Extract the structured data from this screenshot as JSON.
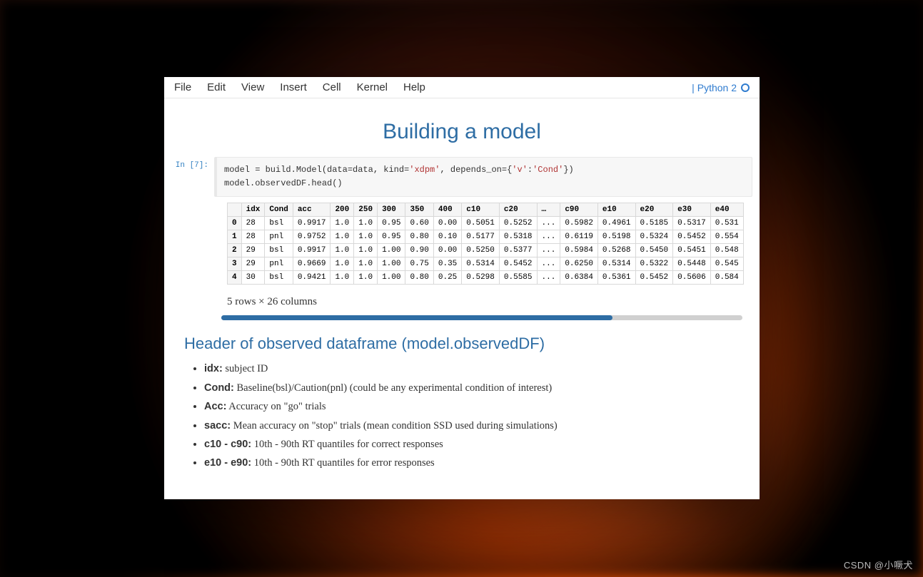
{
  "menubar": {
    "items": [
      "File",
      "Edit",
      "View",
      "Insert",
      "Cell",
      "Kernel",
      "Help"
    ],
    "kernel_name": "Python 2"
  },
  "title": "Building a model",
  "code": {
    "prompt": "In [7]:",
    "line1a": "model = build.Model(data=data, kind=",
    "line1b": "'xdpm'",
    "line1c": ", depends_on={",
    "line1d": "'v'",
    "line1e": ":",
    "line1f": "'Cond'",
    "line1g": "})",
    "line2": "model.observedDF.head()"
  },
  "table": {
    "columns": [
      "idx",
      "Cond",
      "acc",
      "200",
      "250",
      "300",
      "350",
      "400",
      "c10",
      "c20",
      "…",
      "c90",
      "e10",
      "e20",
      "e30",
      "e40"
    ],
    "rows": [
      {
        "index": "0",
        "cells": [
          "28",
          "bsl",
          "0.9917",
          "1.0",
          "1.0",
          "0.95",
          "0.60",
          "0.00",
          "0.5051",
          "0.5252",
          "...",
          "0.5982",
          "0.4961",
          "0.5185",
          "0.5317",
          "0.531"
        ]
      },
      {
        "index": "1",
        "cells": [
          "28",
          "pnl",
          "0.9752",
          "1.0",
          "1.0",
          "0.95",
          "0.80",
          "0.10",
          "0.5177",
          "0.5318",
          "...",
          "0.6119",
          "0.5198",
          "0.5324",
          "0.5452",
          "0.554"
        ]
      },
      {
        "index": "2",
        "cells": [
          "29",
          "bsl",
          "0.9917",
          "1.0",
          "1.0",
          "1.00",
          "0.90",
          "0.00",
          "0.5250",
          "0.5377",
          "...",
          "0.5984",
          "0.5268",
          "0.5450",
          "0.5451",
          "0.548"
        ]
      },
      {
        "index": "3",
        "cells": [
          "29",
          "pnl",
          "0.9669",
          "1.0",
          "1.0",
          "1.00",
          "0.75",
          "0.35",
          "0.5314",
          "0.5452",
          "...",
          "0.6250",
          "0.5314",
          "0.5322",
          "0.5448",
          "0.545"
        ]
      },
      {
        "index": "4",
        "cells": [
          "30",
          "bsl",
          "0.9421",
          "1.0",
          "1.0",
          "1.00",
          "0.80",
          "0.25",
          "0.5298",
          "0.5585",
          "...",
          "0.6384",
          "0.5361",
          "0.5452",
          "0.5606",
          "0.584"
        ]
      }
    ],
    "footer": "5 rows × 26 columns"
  },
  "section_header": "Header of observed dataframe (model.observedDF)",
  "fields": [
    {
      "name": "idx:",
      "desc": " subject ID"
    },
    {
      "name": "Cond:",
      "desc": " Baseline(bsl)/Caution(pnl) (could be any experimental condition of interest)"
    },
    {
      "name": "Acc:",
      "desc": " Accuracy on \"go\" trials"
    },
    {
      "name": "sacc:",
      "desc": " Mean accuracy on \"stop\" trials (mean condition SSD used during simulations)"
    },
    {
      "name": "c10 - c90:",
      "desc": " 10th - 90th RT quantiles for correct responses"
    },
    {
      "name": "e10 - e90:",
      "desc": " 10th - 90th RT quantiles for error responses"
    }
  ],
  "watermark": "CSDN @小噘犬"
}
